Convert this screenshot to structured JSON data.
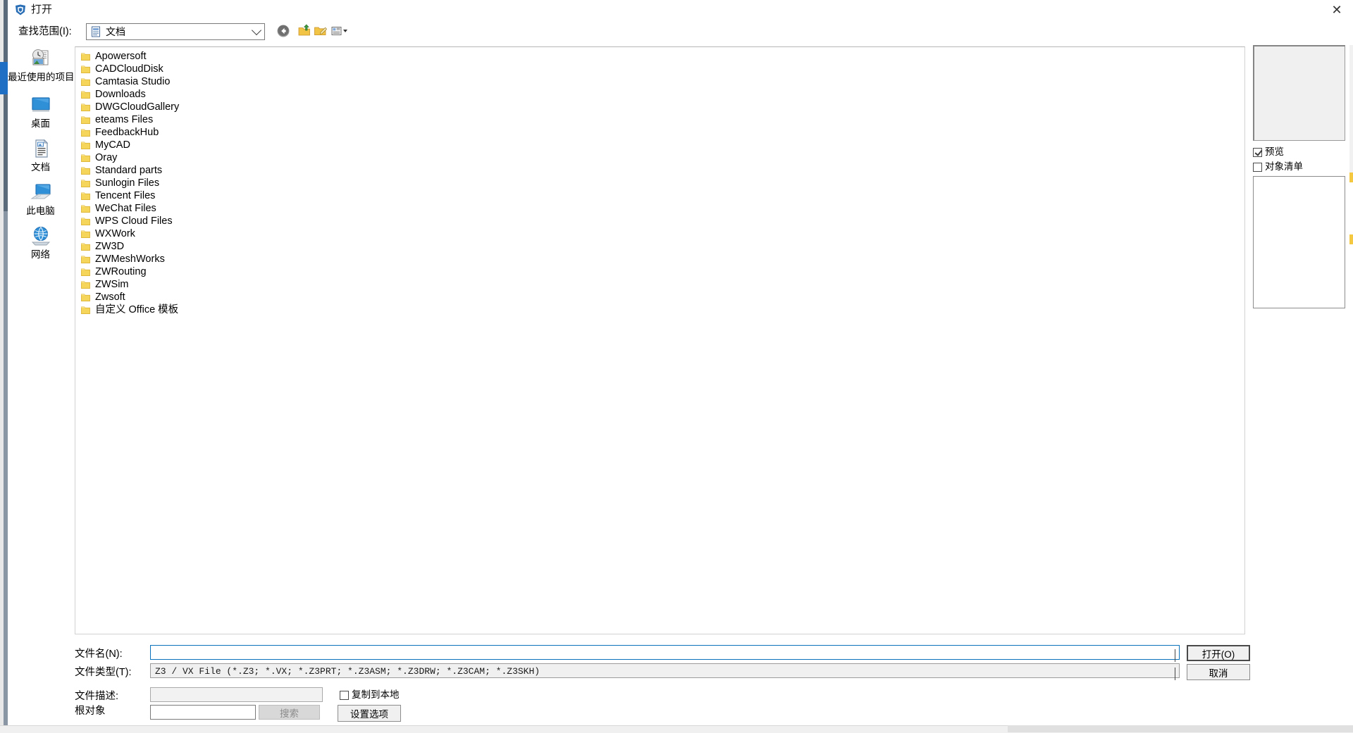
{
  "window": {
    "title": "打开",
    "title_icon": "app-logo-icon",
    "close_label": "✕"
  },
  "toolbar": {
    "lookin_label": "查找范围(I):",
    "lookin_value": "文档",
    "lookin_icon": "documents-folder-icon",
    "buttons": [
      {
        "name": "back-button",
        "icon": "back-arrow-icon",
        "tooltip": "返回"
      },
      {
        "name": "up-one-level-button",
        "icon": "up-folder-icon",
        "tooltip": "向上一级"
      },
      {
        "name": "new-folder-button",
        "icon": "new-folder-icon",
        "tooltip": "新建文件夹"
      },
      {
        "name": "views-button",
        "icon": "views-grid-icon",
        "tooltip": "视图"
      }
    ]
  },
  "places": [
    {
      "label": "最近使用的项目",
      "icon": "recent-items-icon"
    },
    {
      "label": "桌面",
      "icon": "desktop-monitor-icon"
    },
    {
      "label": "文档",
      "icon": "documents-icon"
    },
    {
      "label": "此电脑",
      "icon": "this-pc-icon"
    },
    {
      "label": "网络",
      "icon": "network-globe-icon"
    }
  ],
  "file_list": {
    "items": [
      "Apowersoft",
      "CADCloudDisk",
      "Camtasia Studio",
      "Downloads",
      "DWGCloudGallery",
      "eteams Files",
      "FeedbackHub",
      "MyCAD",
      "Oray",
      "Standard parts",
      "Sunlogin Files",
      "Tencent Files",
      "WeChat Files",
      "WPS Cloud Files",
      "WXWork",
      "ZW3D",
      "ZWMeshWorks",
      "ZWRouting",
      "ZWSim",
      "Zwsoft",
      "自定义 Office 模板"
    ]
  },
  "preview": {
    "preview_checkbox_label": "预览",
    "preview_checked": true,
    "objectlist_checkbox_label": "对象清单",
    "objectlist_checked": false
  },
  "form": {
    "filename_label": "文件名(N):",
    "filename_value": "",
    "filetype_label": "文件类型(T):",
    "filetype_value": "Z3 / VX File (*.Z3; *.VX; *.Z3PRT; *.Z3ASM; *.Z3DRW; *.Z3CAM; *.Z3SKH)",
    "filedesc_label": "文件描述:",
    "filedesc_value": "",
    "rootobj_label": "根对象",
    "rootobj_value": "",
    "search_button_label": "搜索",
    "copylocal_label": "复制到本地",
    "copylocal_checked": false,
    "setoptions_button_label": "设置选项"
  },
  "actions": {
    "open_label": "打开(O)",
    "cancel_label": "取消"
  },
  "colors": {
    "accent": "#1f6fc4",
    "folder": "#f5d55a",
    "focus_border": "#0a72bb"
  }
}
